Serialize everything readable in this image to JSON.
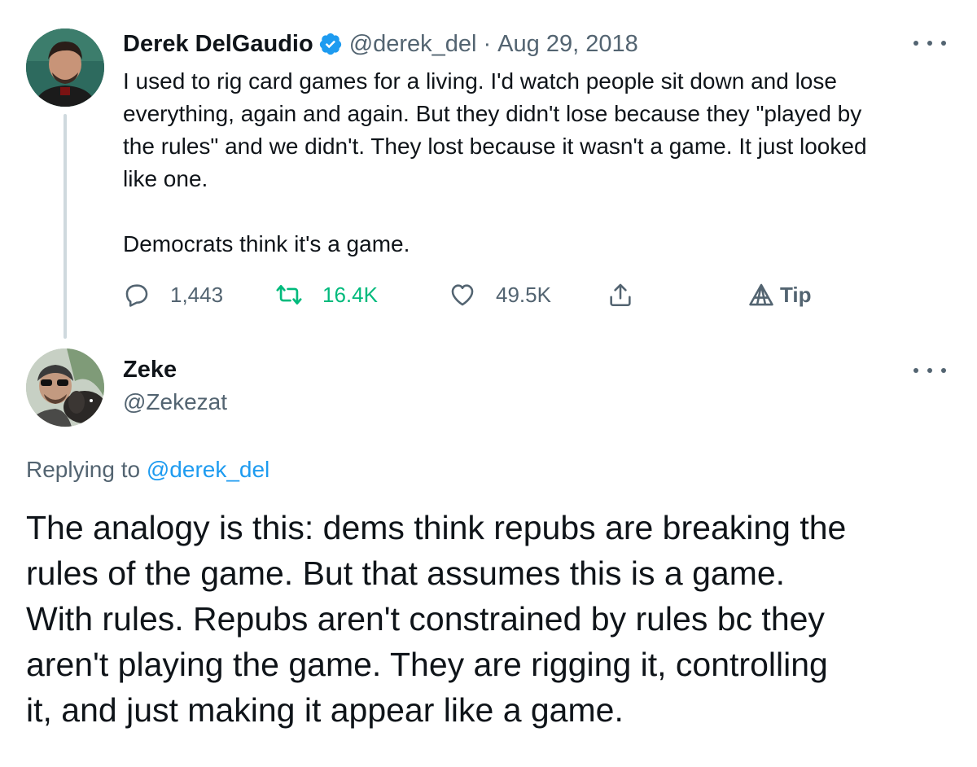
{
  "tweet": {
    "author_name": "Derek DelGaudio",
    "handle": "@derek_del",
    "separator": "·",
    "date": "Aug 29, 2018",
    "text": "I used to rig card games for a living. I'd watch people sit down and lose\neverything, again and again. But they didn't lose because they \"played by\nthe rules\" and we didn't. They lost because it wasn't a game. It just looked\nlike one.\n\nDemocrats think it's a game.",
    "actions": {
      "reply_count": "1,443",
      "retweet_count": "16.4K",
      "like_count": "49.5K",
      "tip_label": "Tip"
    }
  },
  "reply": {
    "author_name": "Zeke",
    "handle": "@Zekezat",
    "replying_prefix": "Replying to",
    "replying_to": "@derek_del",
    "text": "The analogy is this: dems think repubs are breaking the\nrules of the game. But that assumes this is a game.\nWith rules. Repubs aren't constrained by rules bc they\naren't playing the game. They are rigging it, controlling\nit, and just making it appear like a game."
  },
  "icons": [
    "verified-badge-icon",
    "more-icon",
    "reply-icon",
    "retweet-icon",
    "like-icon",
    "share-icon",
    "tip-icon"
  ],
  "colors": {
    "accent": "#1d9bf0",
    "retweet": "#00ba7c",
    "muted": "#536471",
    "text": "#0f1419",
    "thread_line": "#cfd9de"
  }
}
